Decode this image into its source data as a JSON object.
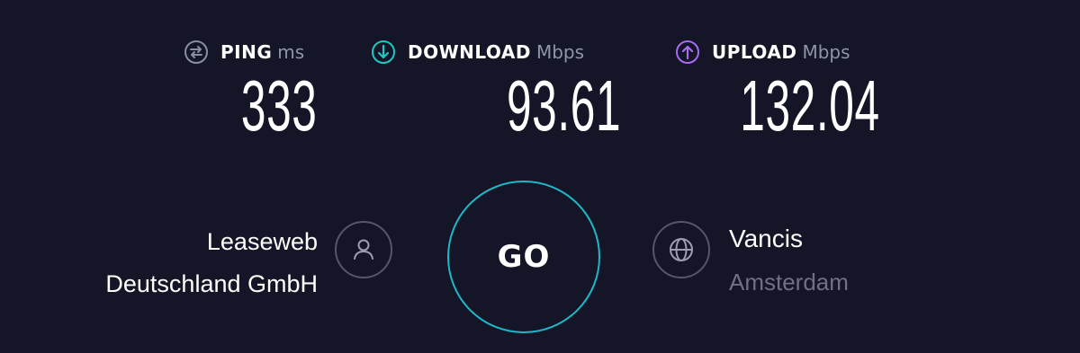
{
  "metrics": {
    "ping": {
      "label": "PING",
      "unit": "ms",
      "value": "333",
      "icon": "ping-icon",
      "color": "#8a8ca0"
    },
    "download": {
      "label": "DOWNLOAD",
      "unit": "Mbps",
      "value": "93.61",
      "icon": "download-arrow-icon",
      "color": "#1fc8c0"
    },
    "upload": {
      "label": "UPLOAD",
      "unit": "Mbps",
      "value": "132.04",
      "icon": "upload-arrow-icon",
      "color": "#a66bf0"
    }
  },
  "provider": {
    "name_line1": "Leaseweb",
    "name_line2": "Deutschland GmbH",
    "icon": "person-icon"
  },
  "go_button": {
    "label": "GO",
    "color": "#1fb7c7"
  },
  "server": {
    "name": "Vancis",
    "location": "Amsterdam",
    "icon": "globe-icon"
  },
  "colors": {
    "background": "#141526",
    "muted_text": "#6f7084",
    "ring_border": "#55566a"
  }
}
